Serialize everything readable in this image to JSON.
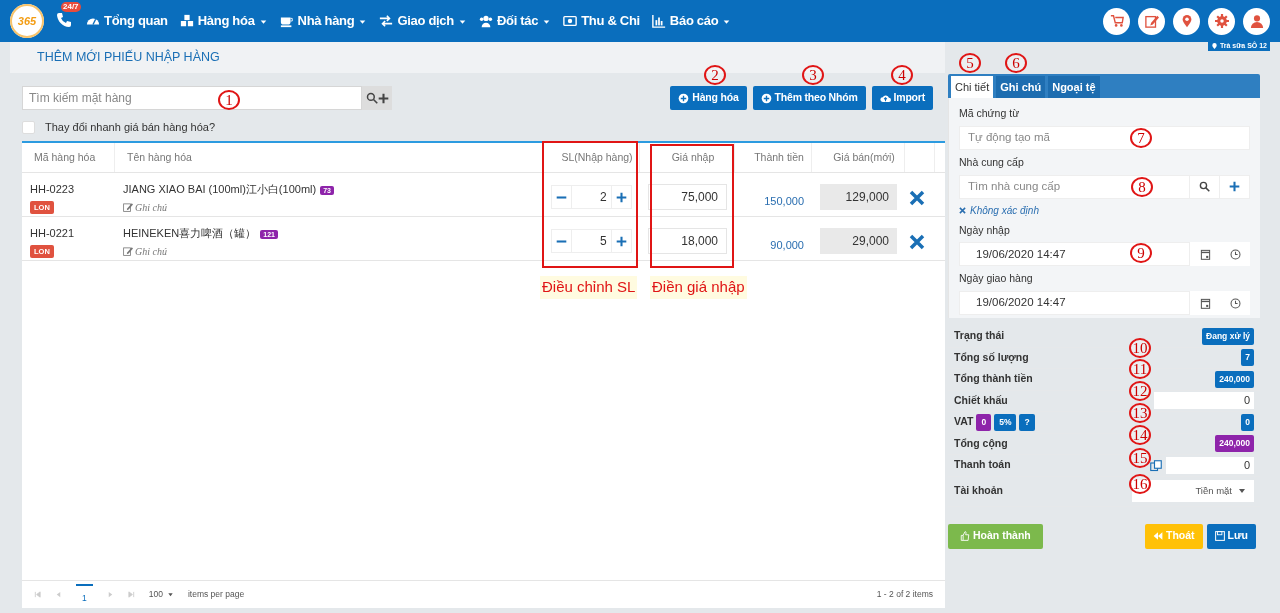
{
  "nav": {
    "logo": "365",
    "hotline_badge": "24/7",
    "items": [
      {
        "label": "Tổng quan",
        "dropdown": false
      },
      {
        "label": "Hàng hóa",
        "dropdown": true
      },
      {
        "label": "Nhà hàng",
        "dropdown": true
      },
      {
        "label": "Giao dịch",
        "dropdown": true
      },
      {
        "label": "Đối tác",
        "dropdown": true
      },
      {
        "label": "Thu & Chi",
        "dropdown": false
      },
      {
        "label": "Báo cáo",
        "dropdown": true
      }
    ],
    "store": "Trà sữa SÔ 12"
  },
  "page_title": "THÊM MỚI PHIẾU NHẬP HÀNG",
  "search": {
    "placeholder": "Tìm kiếm mặt hàng"
  },
  "buttons": [
    "Hàng hóa",
    "Thêm theo Nhóm",
    "Import"
  ],
  "quick_price": {
    "label": "Thay đổi nhanh giá bán hàng hóa?",
    "checked": false
  },
  "table": {
    "columns": [
      "Mã hàng hóa",
      "Tên hàng hóa",
      "SL(Nhập hàng)",
      "Giá nhập",
      "Thành tiền",
      "Giá bán(mới)"
    ],
    "rows": [
      {
        "code": "HH-0223",
        "unit": "LON",
        "name": "JIANG XIAO BAI (100ml)江小白(100ml)",
        "stock": "73",
        "note": "Ghi chú",
        "qty": "2",
        "price": "75,000",
        "total": "150,000",
        "sale_price": "129,000"
      },
      {
        "code": "HH-0221",
        "unit": "LON",
        "name": "HEINEKEN喜力啤酒（罐）",
        "stock": "121",
        "note": "Ghi chú",
        "qty": "5",
        "price": "18,000",
        "total": "90,000",
        "sale_price": "29,000"
      }
    ]
  },
  "pager": {
    "page": "1",
    "per_page": "100",
    "per_page_label": "items per page",
    "summary": "1 - 2 of 2 items"
  },
  "tabs": [
    {
      "label": "Chi tiết",
      "selected": true
    },
    {
      "label": "Ghi chú",
      "selected": false
    },
    {
      "label": "Ngoại tệ",
      "selected": false
    }
  ],
  "form": {
    "code_label": "Mã chứng từ",
    "code_placeholder": "Tự động tạo mã",
    "supplier_label": "Nhà cung cấp",
    "supplier_placeholder": "Tìm nhà cung cấp",
    "supplier_unknown": "Không xác định",
    "import_date_label": "Ngày nhập",
    "import_date": "19/06/2020 14:47",
    "delivery_date_label": "Ngày giao hàng",
    "delivery_date": "19/06/2020 14:47"
  },
  "summary": [
    {
      "kind": "badge",
      "label": "Trạng thái",
      "value": "Đang xử lý",
      "color": "#0a6ebd"
    },
    {
      "kind": "badge",
      "label": "Tổng số lượng",
      "value": "7",
      "color": "#0a6ebd"
    },
    {
      "kind": "badge",
      "label": "Tổng thành tiền",
      "value": "240,000",
      "color": "#0a6ebd"
    },
    {
      "kind": "input",
      "label": "Chiết khấu",
      "value": "0"
    },
    {
      "kind": "vat",
      "label": "VAT",
      "chips": [
        {
          "text": "0",
          "color": "#8e24aa"
        },
        {
          "text": "5%",
          "color": "#0a6ebd"
        },
        {
          "text": "?",
          "color": "#0a6ebd"
        }
      ],
      "value": "0",
      "color": "#0a6ebd"
    },
    {
      "kind": "badge",
      "label": "Tổng cộng",
      "value": "240,000",
      "color": "#8e24aa"
    },
    {
      "kind": "payment",
      "label": "Thanh toán",
      "value": "0"
    },
    {
      "kind": "select",
      "label": "Tài khoản",
      "value": "Tiền mặt"
    }
  ],
  "actions": [
    {
      "kind": "success",
      "label": "Hoàn thành"
    },
    {
      "kind": "warning",
      "label": "Thoát"
    },
    {
      "kind": "primary",
      "label": "Lưu"
    }
  ],
  "annotations": {
    "callouts": [
      "1",
      "2",
      "3",
      "4",
      "5",
      "6",
      "7",
      "8",
      "9",
      "10",
      "11",
      "12",
      "13",
      "14",
      "15",
      "16"
    ],
    "boxes": [
      {
        "caption": "Điều chỉnh SL"
      },
      {
        "caption": "Điền giá nhập"
      }
    ]
  }
}
